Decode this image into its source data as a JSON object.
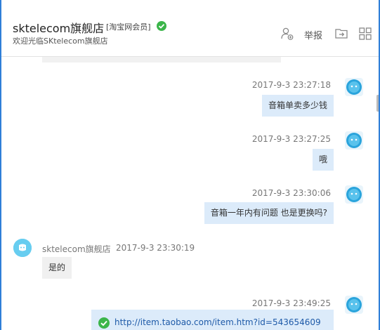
{
  "header": {
    "store_name": "sktelecom旗舰店",
    "store_badge": "[淘宝网会员]",
    "welcome": "欢迎光临SKtelecom旗舰店",
    "report_label": "举报",
    "icons": [
      "add-user-icon",
      "export-icon",
      "grid-icon"
    ]
  },
  "messages": [
    {
      "from": "me",
      "time": "2017-9-3 23:27:18",
      "text": "音箱单卖多少钱"
    },
    {
      "from": "me",
      "time": "2017-9-3 23:27:25",
      "text": "哦"
    },
    {
      "from": "me",
      "time": "2017-9-3 23:30:06",
      "text": "音箱一年内有问题 也是更换吗?"
    },
    {
      "from": "shop",
      "sender": "sktelecom旗舰店",
      "time": "2017-9-3 23:30:19",
      "text": "是的"
    },
    {
      "from": "me",
      "time": "2017-9-3 23:49:25",
      "text": "http://item.taobao.com/item.htm?id=543654609"
    }
  ],
  "colors": {
    "accent": "#2f7fd8",
    "bubble_out": "#dcebfa",
    "bubble_in": "#f0f0f0",
    "verified": "#3bb54a",
    "link": "#1e5aa8"
  }
}
